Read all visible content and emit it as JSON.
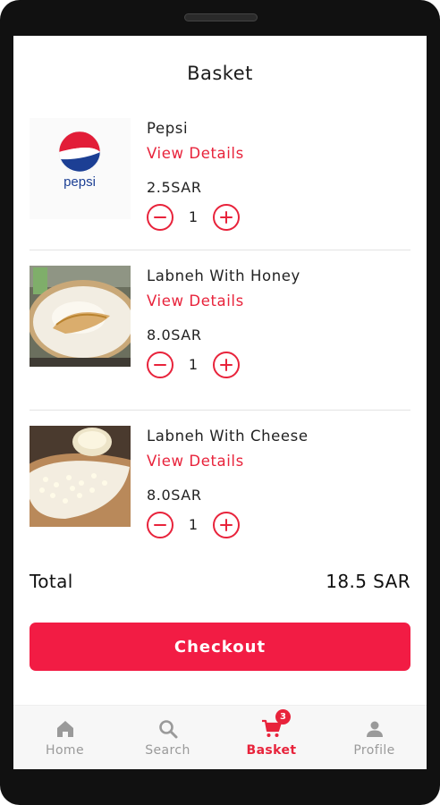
{
  "page": {
    "title": "Basket"
  },
  "items": [
    {
      "name": "Pepsi",
      "details_label": "View Details",
      "price": "2.5SAR",
      "quantity": "1",
      "logo_text": "pepsi"
    },
    {
      "name": "Labneh With Honey",
      "details_label": "View Details",
      "price": "8.0SAR",
      "quantity": "1"
    },
    {
      "name": "Labneh With Cheese",
      "details_label": "View Details",
      "price": "8.0SAR",
      "quantity": "1"
    }
  ],
  "summary": {
    "total_label": "Total",
    "total_value": "18.5 SAR"
  },
  "checkout": {
    "label": "Checkout"
  },
  "nav": {
    "items": [
      {
        "label": "Home",
        "icon": "home-icon"
      },
      {
        "label": "Search",
        "icon": "search-icon"
      },
      {
        "label": "Basket",
        "icon": "cart-icon",
        "badge": "3",
        "active": true
      },
      {
        "label": "Profile",
        "icon": "user-icon"
      }
    ]
  },
  "colors": {
    "accent": "#e8233b",
    "button": "#f21c44",
    "inactive": "#9a9a9a"
  }
}
